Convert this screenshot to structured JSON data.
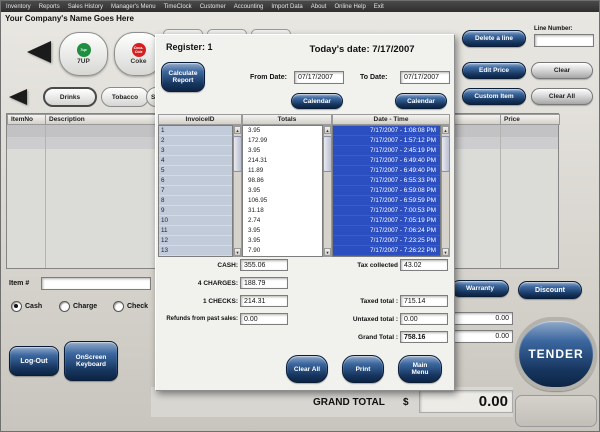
{
  "colors": {
    "navy_button": "#16355e",
    "selection_blue": "#2b4fc0",
    "background": "#d9d6d0",
    "seven_up_green": "#1e8f3e",
    "coke_red": "#d42020"
  },
  "icons": {
    "scroll_up": "▲",
    "scroll_down": "▼"
  },
  "menu": {
    "items": [
      "Inventory",
      "Reports",
      "Sales History",
      "Manager's Menu",
      "TimeClock",
      "Customer",
      "Accounting",
      "Import Data",
      "About",
      "Online Help",
      "Exit"
    ]
  },
  "header": {
    "company_name": "Your Company's Name Goes Here"
  },
  "catalog": {
    "products": [
      {
        "label": "7UP",
        "logo": "7up"
      },
      {
        "label": "Coke",
        "logo": "Coca-Cola"
      }
    ],
    "tabs": {
      "drinks": "Drinks",
      "tobacco": "Tobacco",
      "third": "Se"
    }
  },
  "item_table": {
    "headers": {
      "item_no": "ItemNo",
      "description": "Description",
      "price": "Price"
    }
  },
  "right_panel": {
    "delete_line": "Delete a line",
    "edit_price": "Edit Price",
    "custom_item": "Custom Item",
    "clear": "Clear",
    "clear_all": "Clear All",
    "line_number_label": "Line Number:",
    "line_number_value": ""
  },
  "sale": {
    "item_label": "Item #",
    "item_value": "",
    "payment": {
      "cash": "Cash",
      "charge": "Charge",
      "check": "Check",
      "selected": "Cash"
    },
    "logout": "Log-Out",
    "onscreen_keyboard": "OnScreen Keyboard",
    "warranty": "Warranty",
    "discount": "Discount",
    "tender": "TENDER",
    "side_fields": [
      "0.00",
      "0.00"
    ],
    "grand_total_label": "GRAND TOTAL",
    "currency": "$",
    "grand_total_value": "0.00"
  },
  "dialog": {
    "register_title": "Register: 1",
    "date_title": "Today's date: 7/17/2007",
    "calculate_report": "Calculate Report",
    "from_date_label": "From Date:",
    "from_date": "07/17/2007",
    "to_date_label": "To Date:",
    "to_date": "07/17/2007",
    "calendar": "Calendar",
    "list": {
      "headers": {
        "invoice": "InvoiceID",
        "totals": "Totals",
        "datetime": "Date - Time"
      },
      "rows": [
        {
          "id": "1",
          "total": "3.95",
          "dt": "7/17/2007 - 1:08:08 PM"
        },
        {
          "id": "2",
          "total": "172.99",
          "dt": "7/17/2007 - 1:57:12 PM"
        },
        {
          "id": "3",
          "total": "3.95",
          "dt": "7/17/2007 - 2:45:19 PM"
        },
        {
          "id": "4",
          "total": "214.31",
          "dt": "7/17/2007 - 6:49:40 PM"
        },
        {
          "id": "5",
          "total": "11.89",
          "dt": "7/17/2007 - 6:49:40 PM"
        },
        {
          "id": "6",
          "total": "98.86",
          "dt": "7/17/2007 - 6:55:33 PM"
        },
        {
          "id": "7",
          "total": "3.95",
          "dt": "7/17/2007 - 6:59:08 PM"
        },
        {
          "id": "8",
          "total": "106.95",
          "dt": "7/17/2007 - 6:59:59 PM"
        },
        {
          "id": "9",
          "total": "31.18",
          "dt": "7/17/2007 - 7:00:53 PM"
        },
        {
          "id": "10",
          "total": "2.74",
          "dt": "7/17/2007 - 7:05:19 PM"
        },
        {
          "id": "11",
          "total": "3.95",
          "dt": "7/17/2007 - 7:06:24 PM"
        },
        {
          "id": "12",
          "total": "3.95",
          "dt": "7/17/2007 - 7:23:25 PM"
        },
        {
          "id": "13",
          "total": "7.90",
          "dt": "7/17/2007 - 7:26:22 PM"
        }
      ]
    },
    "summary": {
      "cash_label": "CASH:",
      "cash": "355.06",
      "charges_label": "4 CHARGES:",
      "charges": "188.79",
      "checks_label": "1 CHECKS:",
      "checks": "214.31",
      "refunds_label": "Refunds from past sales:",
      "refunds": "0.00",
      "tax_label": "Tax collected",
      "tax": "43.02",
      "taxed_label": "Taxed total :",
      "taxed": "715.14",
      "untaxed_label": "Untaxed total :",
      "untaxed": "0.00",
      "grand_label": "Grand Total :",
      "grand": "758.16"
    },
    "buttons": {
      "clear_all": "Clear All",
      "print": "Print",
      "main_menu": "Main Menu"
    }
  }
}
